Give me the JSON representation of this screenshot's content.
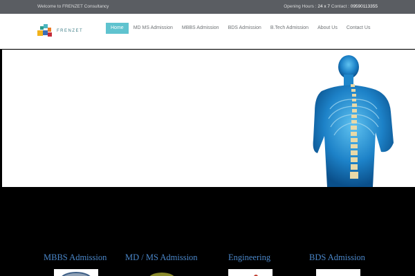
{
  "topbar": {
    "welcome": "Welcome to FRENZET Consultancy",
    "hours_label": "Opening Hours :",
    "hours_value": "24 x 7",
    "contact_label": "Contact :",
    "contact_value": "09590113355"
  },
  "logo": {
    "text": "FRENZET"
  },
  "nav": [
    {
      "label": "Home",
      "active": true
    },
    {
      "label": "MD MS Admission"
    },
    {
      "label": "MBBS Admission"
    },
    {
      "label": "BDS Admission"
    },
    {
      "label": "B.Tech Admission"
    },
    {
      "label": "About Us"
    },
    {
      "label": "Contact Us"
    }
  ],
  "categories": [
    {
      "label": "MBBS Admission"
    },
    {
      "label": "MD / MS Admission"
    },
    {
      "label": "Engineering"
    },
    {
      "label": "BDS Admission"
    }
  ],
  "colors": {
    "accent": "#5fc3cf",
    "topbar": "#5a5d62",
    "category_text": "#4a86c8"
  }
}
